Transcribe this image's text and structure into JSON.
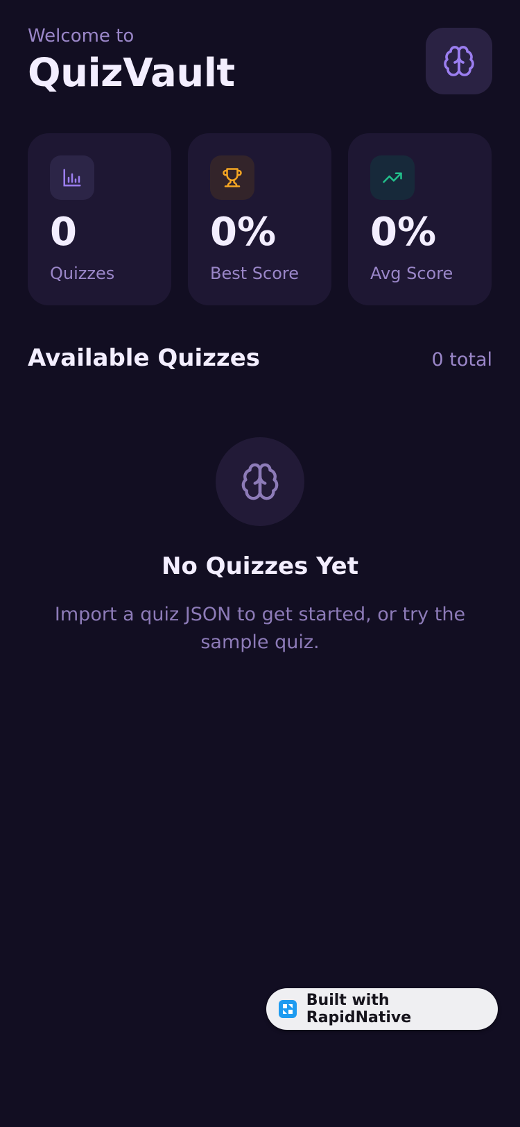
{
  "header": {
    "welcome": "Welcome to",
    "app_title": "QuizVault",
    "brain_icon": "brain-icon"
  },
  "stats": [
    {
      "icon": "bar-chart-icon",
      "value": "0",
      "label": "Quizzes",
      "icon_color": "#9b7ef0",
      "icon_bg": "#2c2547"
    },
    {
      "icon": "trophy-icon",
      "value": "0%",
      "label": "Best Score",
      "icon_color": "#f5a623",
      "icon_bg": "#33242a"
    },
    {
      "icon": "trending-up-icon",
      "value": "0%",
      "label": "Avg Score",
      "icon_color": "#22c08b",
      "icon_bg": "#17293a"
    }
  ],
  "section": {
    "title": "Available Quizzes",
    "count": "0 total"
  },
  "empty_state": {
    "icon": "brain-icon",
    "title": "No Quizzes Yet",
    "text": "Import a quiz JSON to get started, or try the sample quiz."
  },
  "badge": {
    "text": "Built with RapidNative",
    "logo": "rapidnative-logo-icon"
  },
  "colors": {
    "background": "#120e22",
    "card": "#1e1733",
    "accent": "#9b7ef0",
    "muted_text": "#9a86c8"
  }
}
